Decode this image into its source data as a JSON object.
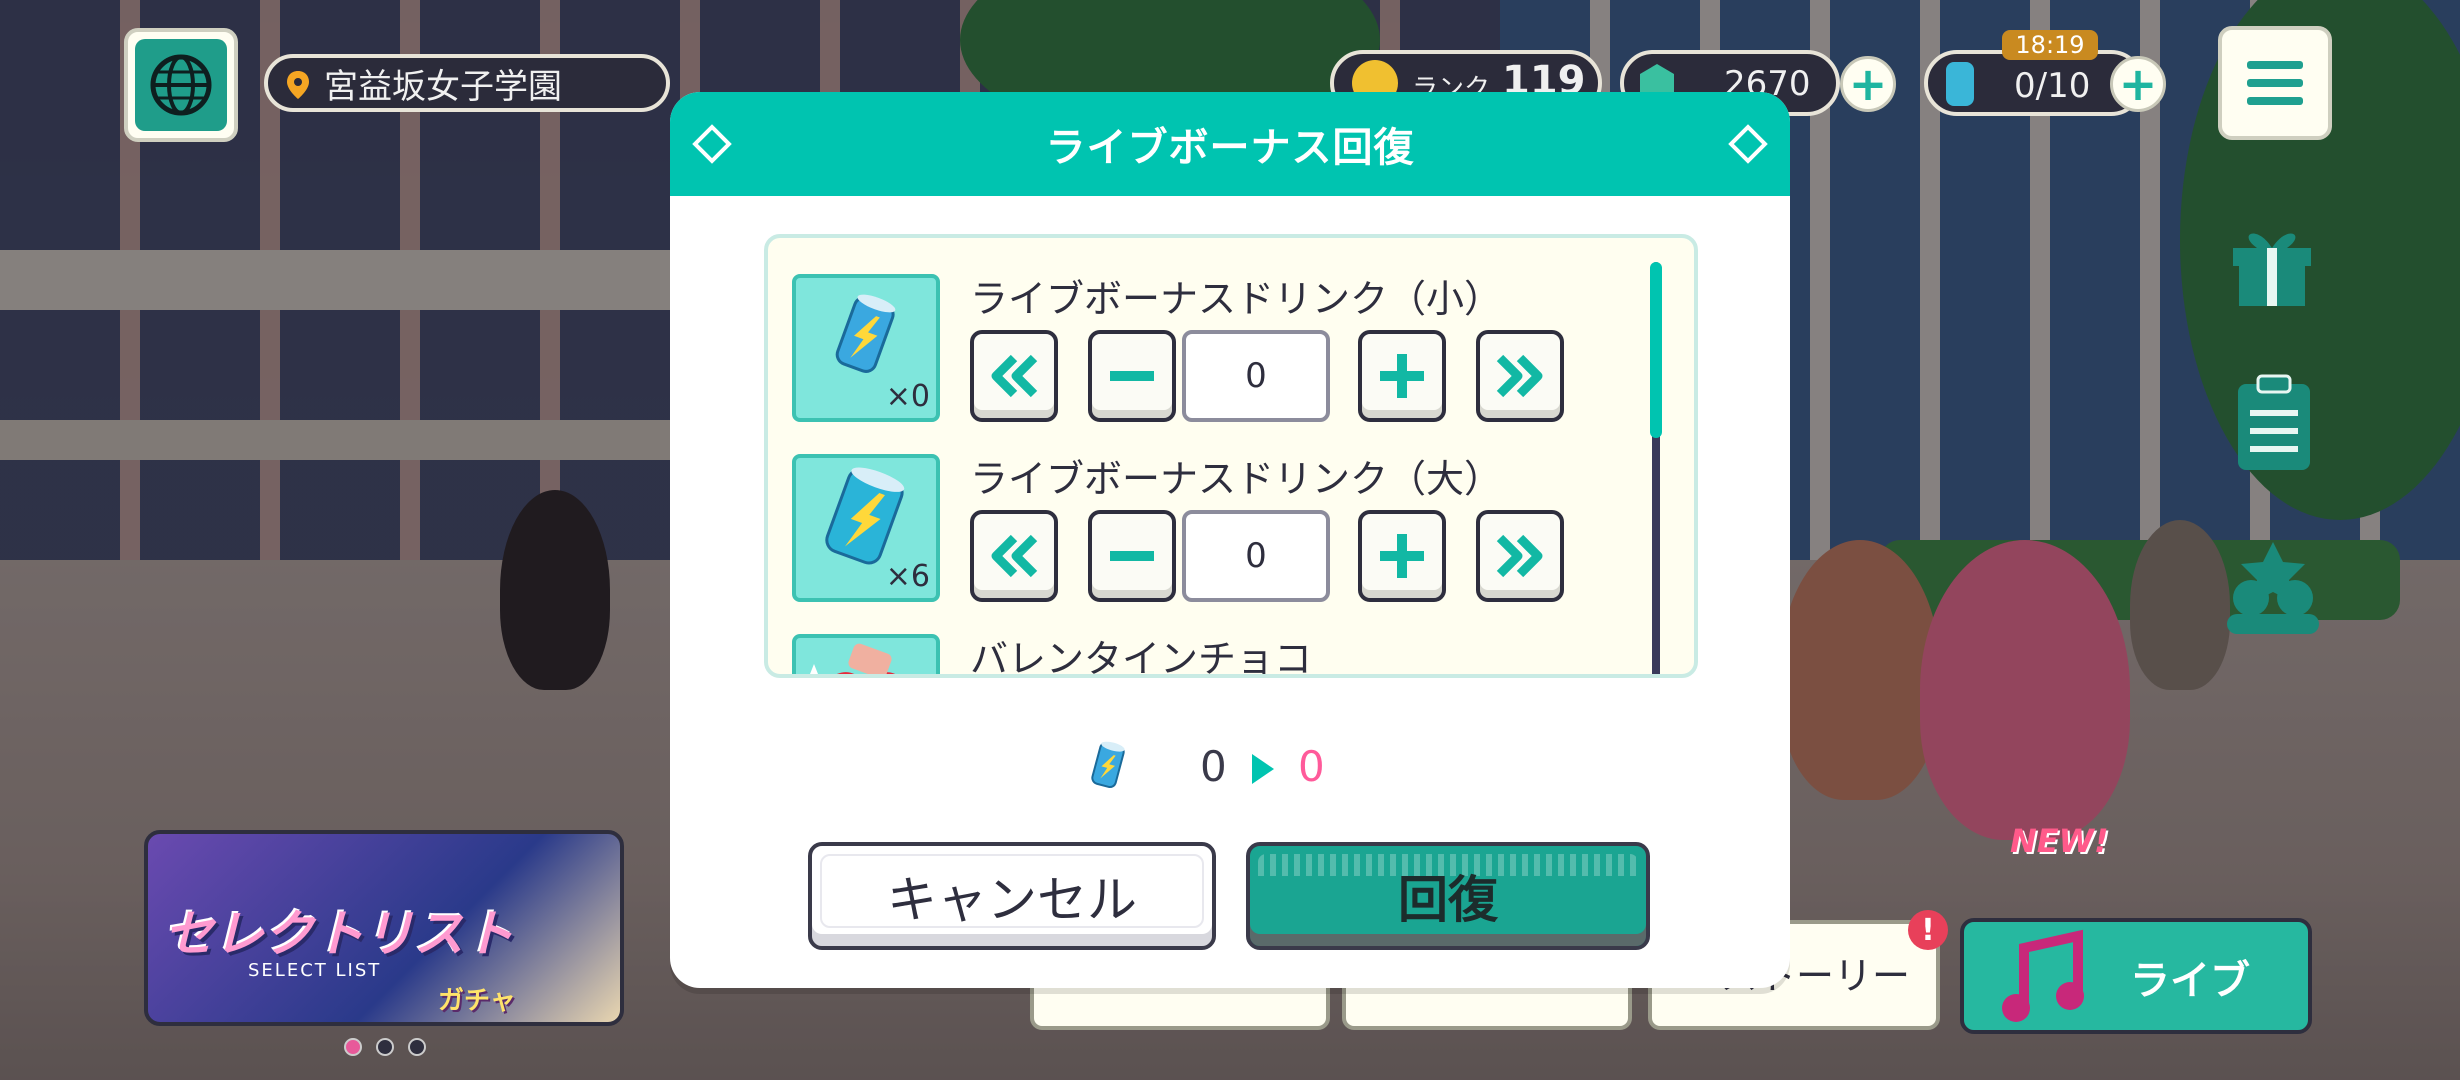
{
  "hud": {
    "location": "宮益坂女子学園",
    "rank_label": "ランク",
    "rank_value": "119",
    "crystals": "2670",
    "bonus_timer": "18:19",
    "bonus_count": "0/10"
  },
  "dialog": {
    "title": "ライブボーナス回復",
    "items": [
      {
        "name": "ライブボーナスドリンク（小）",
        "owned": "×0",
        "quantity": "0"
      },
      {
        "name": "ライブボーナスドリンク（大）",
        "owned": "×6",
        "quantity": "0"
      },
      {
        "name": "バレンタインチョコ",
        "owned": "",
        "quantity": ""
      }
    ],
    "result_from": "0",
    "result_to": "0",
    "cancel_label": "キャンセル",
    "recover_label": "回復"
  },
  "nav": {
    "banner_title": "セレクトリスト",
    "banner_sub": "SELECT LIST",
    "banner_gacha": "ガチャ",
    "story_label": "ストーリー",
    "live_label": "ライブ",
    "new_tag": "NEW!",
    "alert_badge": "!"
  },
  "colors": {
    "accent": "#00c4b0",
    "pink": "#ff5a9a",
    "dark": "#2e2e3e"
  }
}
